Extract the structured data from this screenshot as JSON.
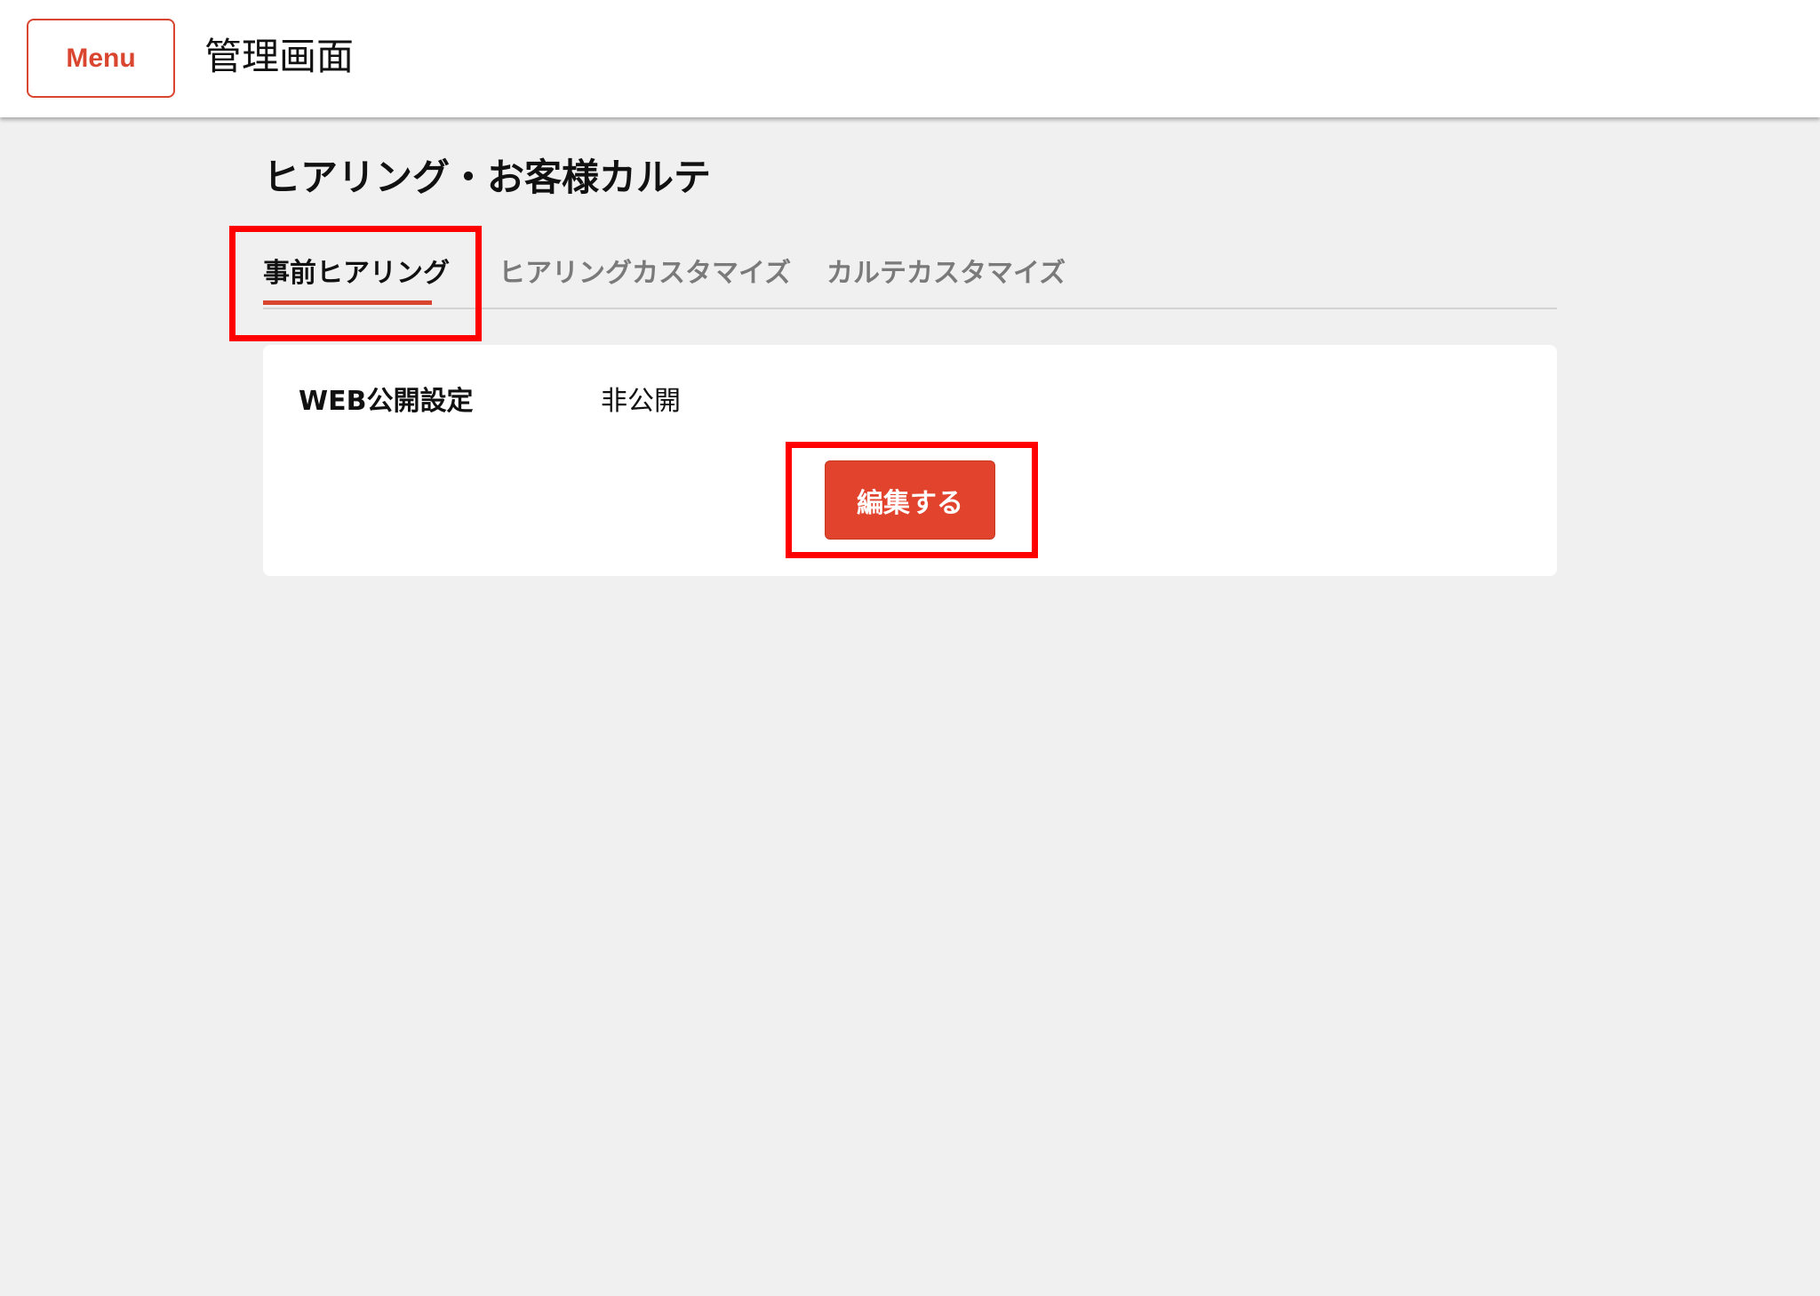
{
  "header": {
    "menu_label": "Menu",
    "title": "管理画面"
  },
  "page": {
    "title": "ヒアリング・お客様カルテ"
  },
  "tabs": [
    {
      "label": "事前ヒアリング",
      "active": true
    },
    {
      "label": "ヒアリングカスタマイズ",
      "active": false
    },
    {
      "label": "カルテカスタマイズ",
      "active": false
    }
  ],
  "settings": {
    "web_publish_label": "WEB公開設定",
    "web_publish_value": "非公開",
    "edit_label": "編集する"
  },
  "colors": {
    "accent": "#e2432c",
    "highlight": "#ff0000",
    "background": "#f0f0f0"
  }
}
